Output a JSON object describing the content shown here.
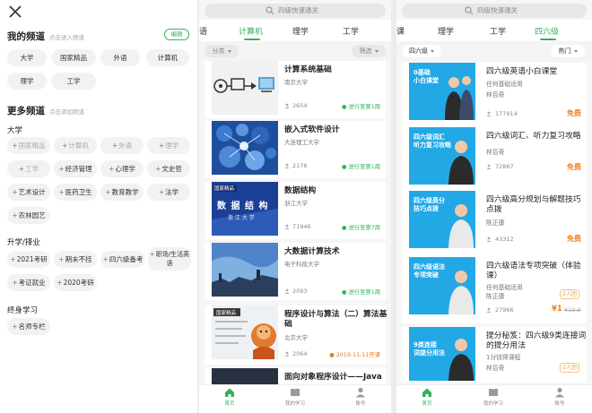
{
  "panel_left": {
    "my_channel": {
      "title": "我的频道",
      "hint": "点击进入频道",
      "edit_label": "编辑",
      "chips": [
        "大学",
        "国家精品",
        "外语",
        "计算机",
        "理学",
        "工学"
      ]
    },
    "more_channel": {
      "title": "更多频道",
      "hint": "点击添加频道",
      "groups": [
        {
          "label": "大学",
          "chips": [
            "国家精品",
            "计算机",
            "外语",
            "理学",
            "工学",
            "经济管理",
            "心理学",
            "文史哲",
            "艺术设计",
            "医药卫生",
            "教育教学",
            "法学",
            "农林园艺"
          ]
        },
        {
          "label": "升学/择业",
          "chips": [
            "2021考研",
            "期末不挂",
            "四六级备考",
            "职场/生活英语",
            "考证就业",
            "2020考研"
          ]
        },
        {
          "label": "终身学习",
          "chips": [
            "名师专栏"
          ]
        }
      ]
    }
  },
  "panel_mid": {
    "search_placeholder": "四级快速通关",
    "tabs": [
      "语",
      "计算机",
      "理学",
      "工学"
    ],
    "filter_left": "分类",
    "filter_right": "筛选",
    "cards": [
      {
        "title": "计算系统基础",
        "school": "南京大学",
        "count": "2654",
        "status": "进行至第1周"
      },
      {
        "title": "嵌入式软件设计",
        "school": "大连理工大学",
        "count": "2176",
        "status": "进行至第1周"
      },
      {
        "title": "数据结构",
        "school": "浙江大学",
        "count": "71946",
        "status": "进行至第7周",
        "thumb_title": "数 据 结 构",
        "thumb_sub": "浙 江 大 学",
        "thumb_badge": "国家精品"
      },
      {
        "title": "大数据计算技术",
        "school": "电子科技大学",
        "count": "2093",
        "status": "进行至第1周"
      },
      {
        "title": "程序设计与算法（二）算法基础",
        "school": "北京大学",
        "count": "2064",
        "status": "2019-11-11开课",
        "thumb_badge": "国家精品"
      },
      {
        "title": "面向对象程序设计——Java"
      }
    ],
    "nav": [
      "首页",
      "我的学习",
      "账号"
    ]
  },
  "panel_right": {
    "search_placeholder": "四级快速通关",
    "tabs": [
      "课",
      "理学",
      "工学",
      "四六级"
    ],
    "filter_left": "四六级",
    "filter_right": "热门",
    "cards": [
      {
        "title": "四六级英语小白课堂",
        "sub": "任何基础适用",
        "teacher": "林百奇",
        "count": "177914",
        "price": "免费",
        "thumb": "0基础\n小白课堂"
      },
      {
        "title": "四六级词汇、听力复习攻略",
        "sub": "",
        "teacher": "林百奇",
        "count": "72867",
        "price": "免费",
        "thumb": "四六级词汇\n听力复习攻略"
      },
      {
        "title": "四六级高分规划与解题技巧点拨",
        "sub": "",
        "teacher": "陈正康",
        "count": "43312",
        "price": "免费",
        "thumb": "四六级高分\n技巧点拨"
      },
      {
        "title": "四六级语法专项突破（体验课）",
        "sub": "任何基础适用",
        "teacher": "陈正康",
        "count": "27966",
        "badge": "2人团",
        "price": "¥1",
        "old_price": "¥19.9",
        "thumb": "四六级语法\n专项突破"
      },
      {
        "title": "提分秘笈：四六级9类连接词的提分用法",
        "sub": "1分钱得课程",
        "teacher": "林百奇",
        "badge": "2人团",
        "thumb": "9类连接\n词提分用法"
      }
    ],
    "nav": [
      "首页",
      "我的学习",
      "账号"
    ]
  },
  "colors": {
    "accent": "#34b15b",
    "free": "#f08420",
    "thumb_blue": "#23a8e6"
  }
}
